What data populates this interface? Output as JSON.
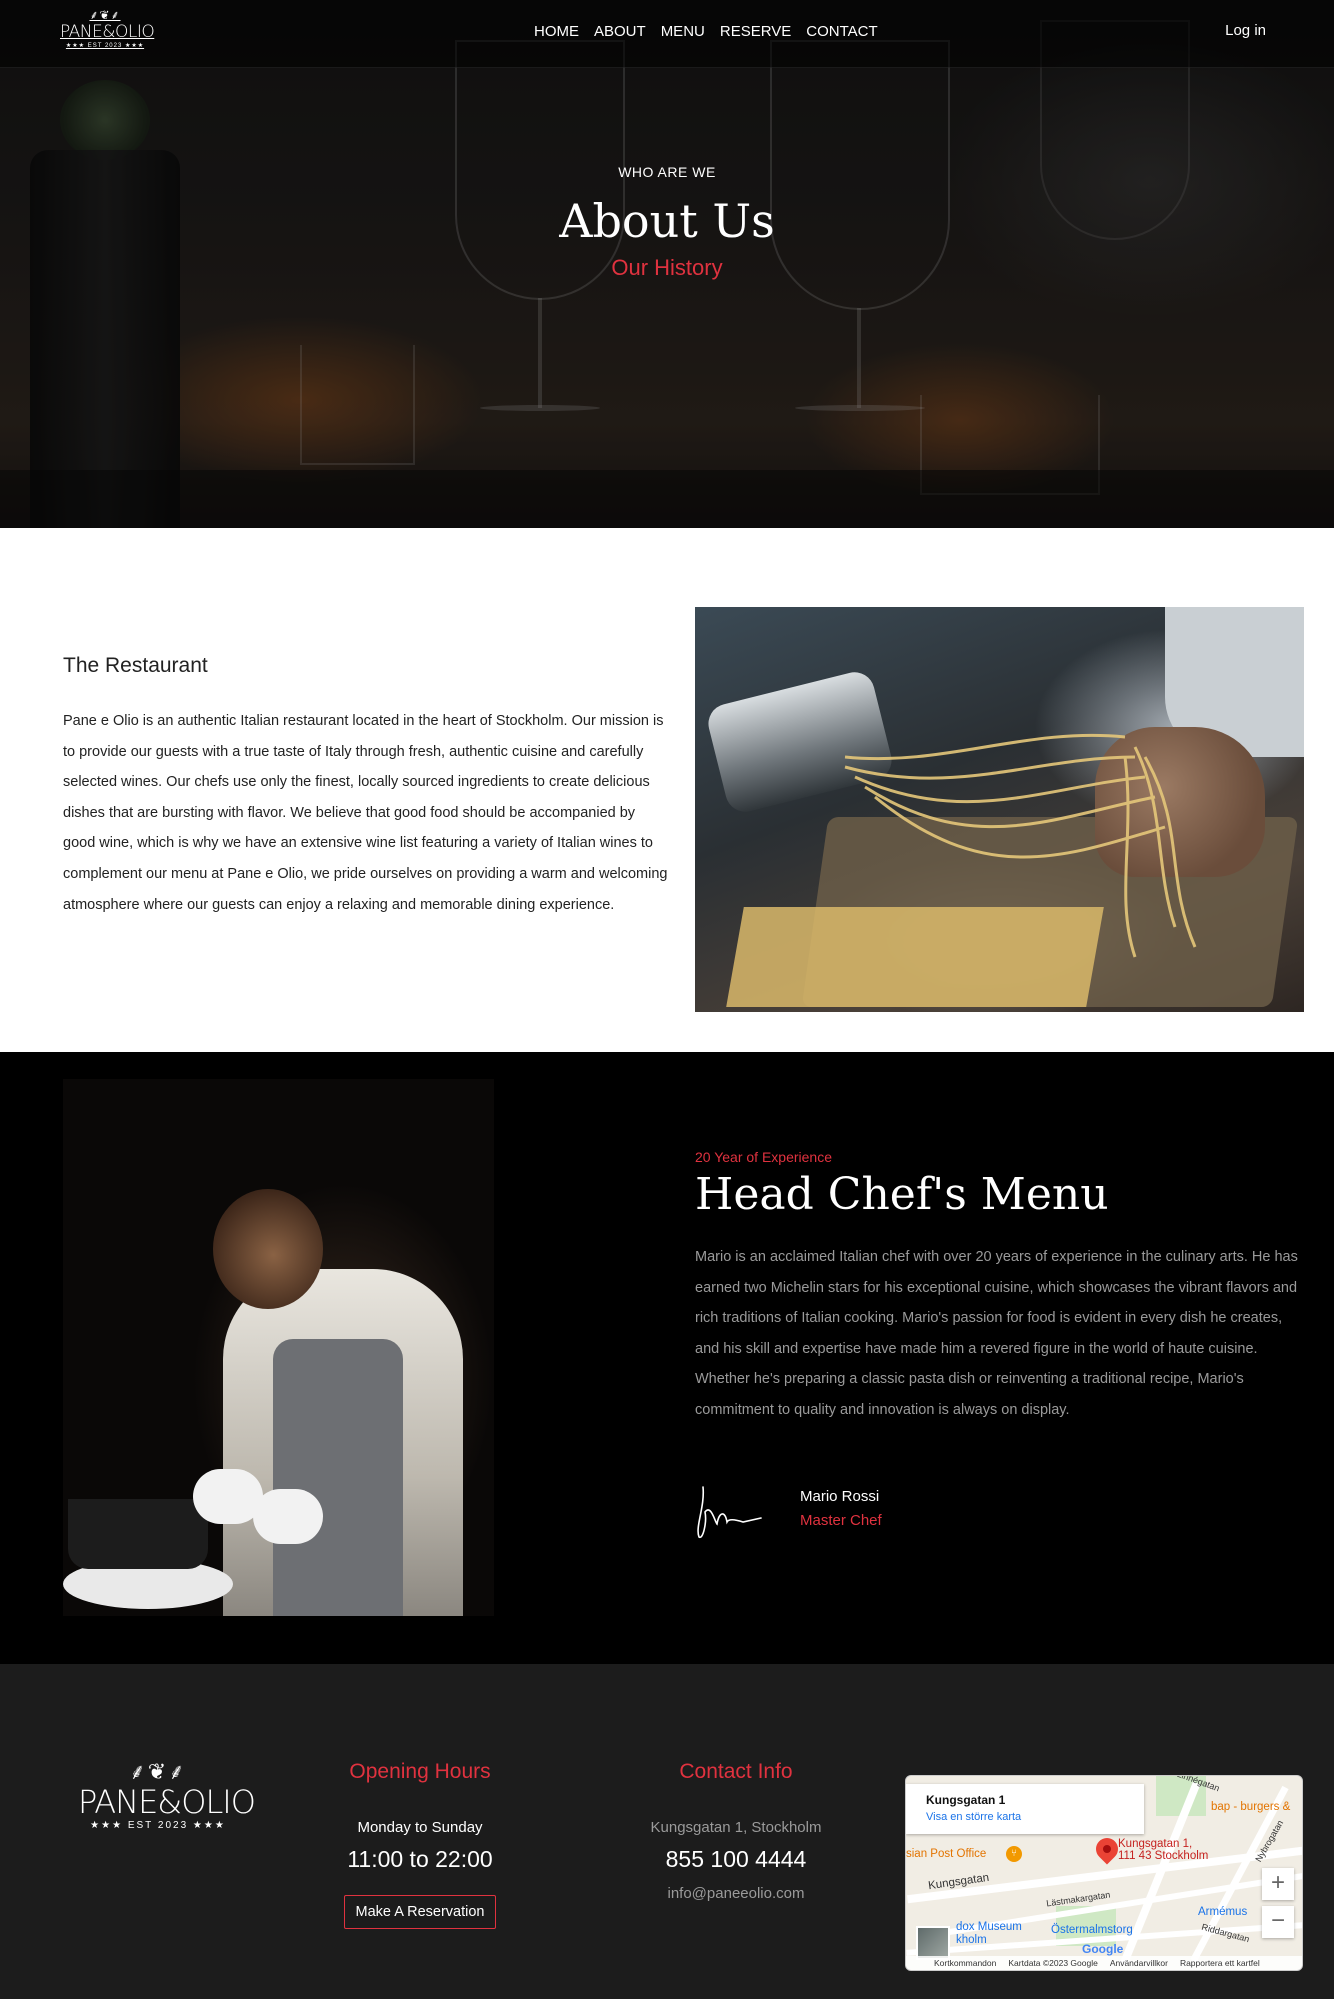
{
  "nav": {
    "logo": {
      "name": "PANE&OLIO",
      "est": "★★★ EST 2023 ★★★"
    },
    "links": [
      {
        "label": "HOME"
      },
      {
        "label": "ABOUT"
      },
      {
        "label": "MENU"
      },
      {
        "label": "RESERVE"
      },
      {
        "label": "CONTACT"
      }
    ],
    "login": "Log in"
  },
  "hero": {
    "kicker": "WHO ARE WE",
    "title": "About Us",
    "subtitle": "Our History"
  },
  "restaurant": {
    "title": "The Restaurant",
    "text": "Pane e Olio is an authentic Italian restaurant located in the heart of Stockholm. Our mission is to provide our guests with a true taste of Italy through fresh, authentic cuisine and carefully selected wines. Our chefs use only the finest, locally sourced ingredients to create delicious dishes that are bursting with flavor. We believe that good food should be accompanied by good wine, which is why we have an extensive wine list featuring a variety of Italian wines to complement our menu at Pane e Olio, we pride ourselves on providing a warm and welcoming atmosphere where our guests can enjoy a relaxing and memorable dining experience."
  },
  "chef": {
    "kicker": "20 Year of Experience",
    "title": "Head Chef's Menu",
    "text": "Mario is an acclaimed Italian chef with over 20 years of experience in the culinary arts. He has earned two Michelin stars for his exceptional cuisine, which showcases the vibrant flavors and rich traditions of Italian cooking. Mario's passion for food is evident in every dish he creates, and his skill and expertise have made him a revered figure in the world of haute cuisine. Whether he's preparing a classic pasta dish or reinventing a traditional recipe, Mario's commitment to quality and innovation is always on display.",
    "name": "Mario Rossi",
    "role": "Master Chef"
  },
  "footer": {
    "logo": {
      "name": "PANE&OLIO",
      "est": "★★★ EST 2023 ★★★"
    },
    "hours": {
      "title": "Opening Hours",
      "days": "Monday to Sunday",
      "time": "11:00 to 22:00",
      "button": "Make A Reservation"
    },
    "contact": {
      "title": "Contact Info",
      "address": "Kungsgatan 1, Stockholm",
      "phone": "855 100 4444",
      "email": "info@paneeolio.com"
    },
    "map": {
      "card_title": "Kungsgatan 1",
      "card_link": "Visa en större karta",
      "pin_label_1": "Kungsgatan 1,",
      "pin_label_2": "111 43 Stockholm",
      "labels": {
        "post": "sian Post Office",
        "burgers": "bap - burgers &",
        "kungsgatan": "Kungsgatan",
        "lastmakargatan": "Lästmakargatan",
        "museum1": "dox Museum",
        "museum2": "kholm",
        "ostermalmstorg": "Östermalmstorg",
        "armemus": "Armémus",
        "lineegatan": "Linnégatan",
        "nybrogatan": "Nybrogatan",
        "riddargatan": "Riddargatan"
      },
      "attribution": [
        "Kortkommandon",
        "Kartdata ©2023 Google",
        "Användarvillkor",
        "Rapportera ett kartfel"
      ],
      "google": "Google",
      "zoom_in": "+",
      "zoom_out": "−"
    }
  },
  "icons": {
    "logo_mark": "wheat-olive-icon",
    "map_pin": "map-pin-icon",
    "signature": "signature-icon"
  },
  "colors": {
    "accent": "#e0323f",
    "dark": "#000000",
    "footer_bg": "#1c1c1c"
  }
}
